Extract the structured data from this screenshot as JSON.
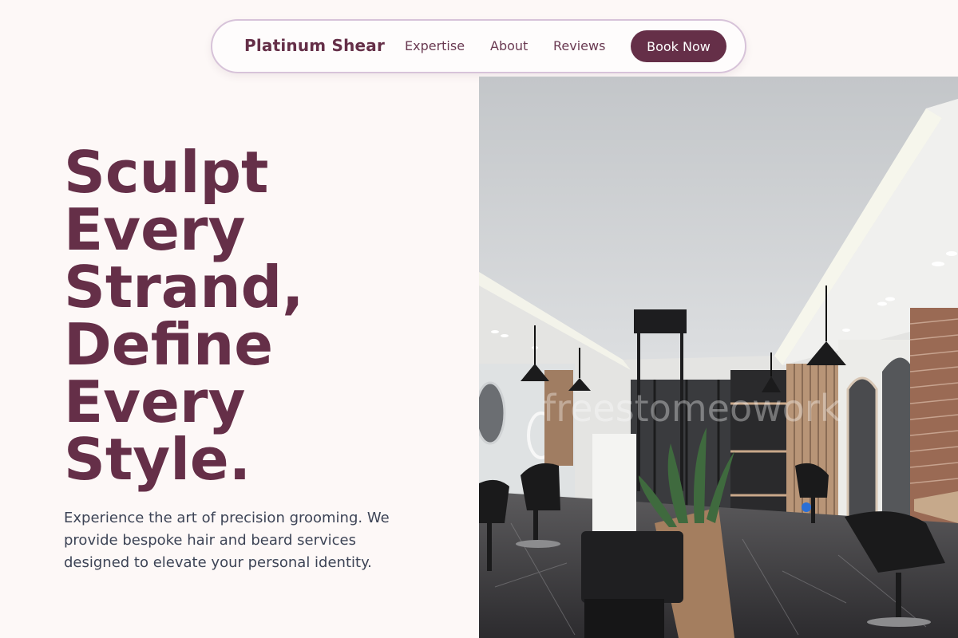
{
  "nav": {
    "brand": "Platinum Shear",
    "links": [
      {
        "label": "Expertise"
      },
      {
        "label": "About"
      },
      {
        "label": "Reviews"
      }
    ],
    "cta_label": "Book Now"
  },
  "hero": {
    "title_lines": [
      "Sculpt",
      "Every",
      "Strand,",
      "Define",
      "Every",
      "Style."
    ],
    "subtitle": "Experience the art of precision grooming. We provide bespoke hair and beard services designed to elevate your personal identity.",
    "image_watermark": "freestomeowork"
  },
  "colors": {
    "accent": "#652f48",
    "background": "#fdf8f7",
    "body_text": "#3d4456",
    "nav_border": "#d7c3d9"
  }
}
